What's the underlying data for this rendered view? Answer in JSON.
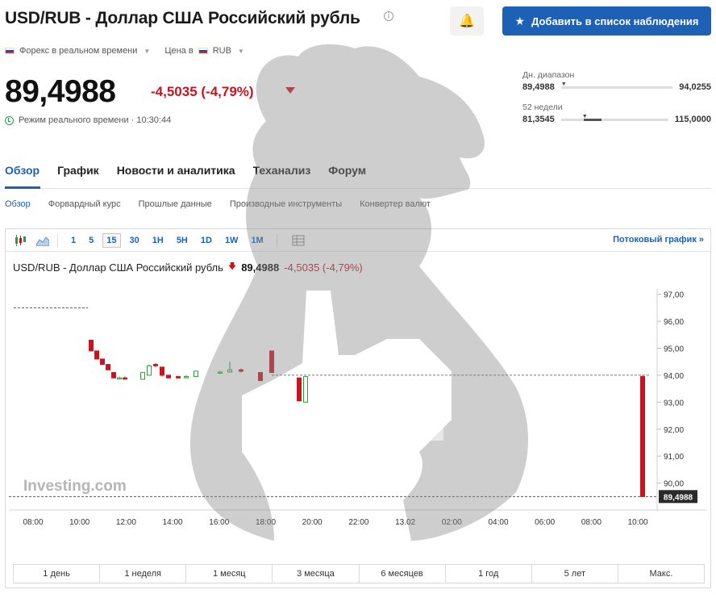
{
  "header": {
    "title": "USD/RUB - Доллар США Российский рубль",
    "watch_label": "Добавить в список наблюдения"
  },
  "meta": {
    "market": "Форекс в реальном времени",
    "price_in_label": "Цена в",
    "currency": "RUB"
  },
  "quote": {
    "price": "89,4988",
    "change": "-4,5035 (-4,79%)",
    "realtime": "Режим реального времени · 10:30:44"
  },
  "ranges": {
    "day_label": "Дн. диапазон",
    "day_low": "89,4988",
    "day_high": "94,0255",
    "week52_label": "52 недели",
    "week52_low": "81,3545",
    "week52_high": "115,0000"
  },
  "tabs": [
    "Обзор",
    "График",
    "Новости и аналитика",
    "Теханализ",
    "Форум"
  ],
  "subtabs": [
    "Обзор",
    "Форвардный курс",
    "Прошлые данные",
    "Производные инструменты",
    "Конвертер валют"
  ],
  "toolbar": {
    "intervals": [
      "1",
      "5",
      "15",
      "30",
      "1H",
      "5H",
      "1D",
      "1W",
      "1M"
    ],
    "selected_interval": "15",
    "stream_link": "Потоковый график »"
  },
  "chart_title": {
    "name": "USD/RUB - Доллар США Российский рубль",
    "price": "89,4988",
    "change": "-4,5035 (-4,79%)"
  },
  "periods": [
    "1 день",
    "1 неделя",
    "1 месяц",
    "3 месяца",
    "6 месяцев",
    "1 год",
    "5 лет",
    "Макс."
  ],
  "colors": {
    "accent": "#1c61b5",
    "down": "#c8141f",
    "up": "#2e9c3a"
  },
  "chart_data": {
    "type": "candlestick",
    "ylim": [
      89.3,
      97.2
    ],
    "yticks": [
      "97,00",
      "96,00",
      "95,00",
      "94,00",
      "93,00",
      "92,00",
      "91,00",
      "90,00"
    ],
    "xticks": [
      "08:00",
      "10:00",
      "12:00",
      "14:00",
      "16:00",
      "18:00",
      "20:00",
      "22:00",
      "13.02",
      "02:00",
      "04:00",
      "06:00",
      "08:00",
      "10:00"
    ],
    "last_price_label": "89,4988",
    "reference_level": 94.0,
    "brand": "Investing.com",
    "series": [
      {
        "o": 95.3,
        "h": 95.3,
        "l": 94.9,
        "c": 94.9
      },
      {
        "o": 94.9,
        "h": 94.9,
        "l": 94.6,
        "c": 94.6
      },
      {
        "o": 94.6,
        "h": 94.6,
        "l": 94.4,
        "c": 94.4
      },
      {
        "o": 94.4,
        "h": 94.4,
        "l": 94.2,
        "c": 94.2
      },
      {
        "o": 94.1,
        "h": 94.1,
        "l": 93.9,
        "c": 93.9
      },
      {
        "o": 93.9,
        "h": 93.95,
        "l": 93.85,
        "c": 93.9
      },
      {
        "o": 93.9,
        "h": 93.95,
        "l": 93.85,
        "c": 93.88
      },
      {
        "o": 93.85,
        "h": 94.1,
        "l": 93.85,
        "c": 94.1
      },
      {
        "o": 94.0,
        "h": 94.4,
        "l": 94.0,
        "c": 94.35
      },
      {
        "o": 94.4,
        "h": 94.45,
        "l": 94.3,
        "c": 94.35
      },
      {
        "o": 94.3,
        "h": 94.3,
        "l": 93.95,
        "c": 94.0
      },
      {
        "o": 94.0,
        "h": 94.0,
        "l": 93.9,
        "c": 93.9
      },
      {
        "o": 93.95,
        "h": 93.98,
        "l": 93.88,
        "c": 93.9
      },
      {
        "o": 93.95,
        "h": 94.0,
        "l": 93.9,
        "c": 93.95
      },
      {
        "o": 93.95,
        "h": 94.15,
        "l": 93.95,
        "c": 94.15
      },
      {
        "o": 94.1,
        "h": 94.15,
        "l": 94.05,
        "c": 94.12
      },
      {
        "o": 94.12,
        "h": 94.5,
        "l": 94.1,
        "c": 94.2
      },
      {
        "o": 94.2,
        "h": 94.25,
        "l": 94.1,
        "c": 94.15
      },
      {
        "o": 94.1,
        "h": 94.1,
        "l": 93.8,
        "c": 93.8
      },
      {
        "o": 94.9,
        "h": 94.9,
        "l": 94.1,
        "c": 94.1
      },
      {
        "o": 93.9,
        "h": 93.9,
        "l": 93.05,
        "c": 93.05
      },
      {
        "o": 93.0,
        "h": 93.95,
        "l": 93.0,
        "c": 93.95
      },
      {
        "o": 93.95,
        "h": 94.0,
        "l": 89.5,
        "c": 89.5
      }
    ]
  }
}
